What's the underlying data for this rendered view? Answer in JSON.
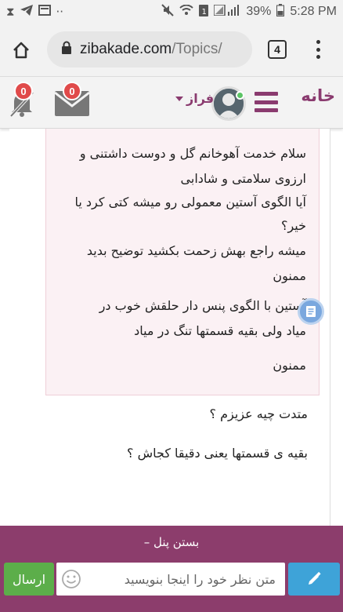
{
  "status_bar": {
    "battery": "39%",
    "time": "5:28 PM",
    "dots": "··"
  },
  "browser": {
    "url_domain": "zibakade.com",
    "url_path": "/Topics/",
    "tab_count": "4"
  },
  "site_header": {
    "home_label": "خانه",
    "user_name": "فراز",
    "mail_badge": "0",
    "notif_badge": "0"
  },
  "quote": {
    "lines": [
      "سلام خدمت آهوخانم گل و دوست داشتنی و",
      "ارزوی سلامتی و شادابی",
      "آیا الگوی آستین معمولی رو میشه کتی کرد یا",
      "خیر؟",
      "میشه راجع بهش زحمت بکشید توضیح بدید",
      "ممنون",
      "آستین با الگوی پنس دار حلقش خوب در",
      "میاد ولی بقیه قسمتها تنگ در میاد",
      "ممنون"
    ]
  },
  "reply": {
    "lines": [
      "متدت چیه عزیزم ؟",
      "بقیه ی قسمتها یعنی دقیقا کجاش ؟"
    ]
  },
  "panel": {
    "close_label": "بستن پنل",
    "input_placeholder": "متن نظر خود را اینجا بنویسید",
    "send_label": "ارسال"
  },
  "colors": {
    "brand": "#8a3b6f",
    "panel": "#8c3d6c",
    "send": "#5cae4a",
    "edit": "#3ea3d8"
  }
}
